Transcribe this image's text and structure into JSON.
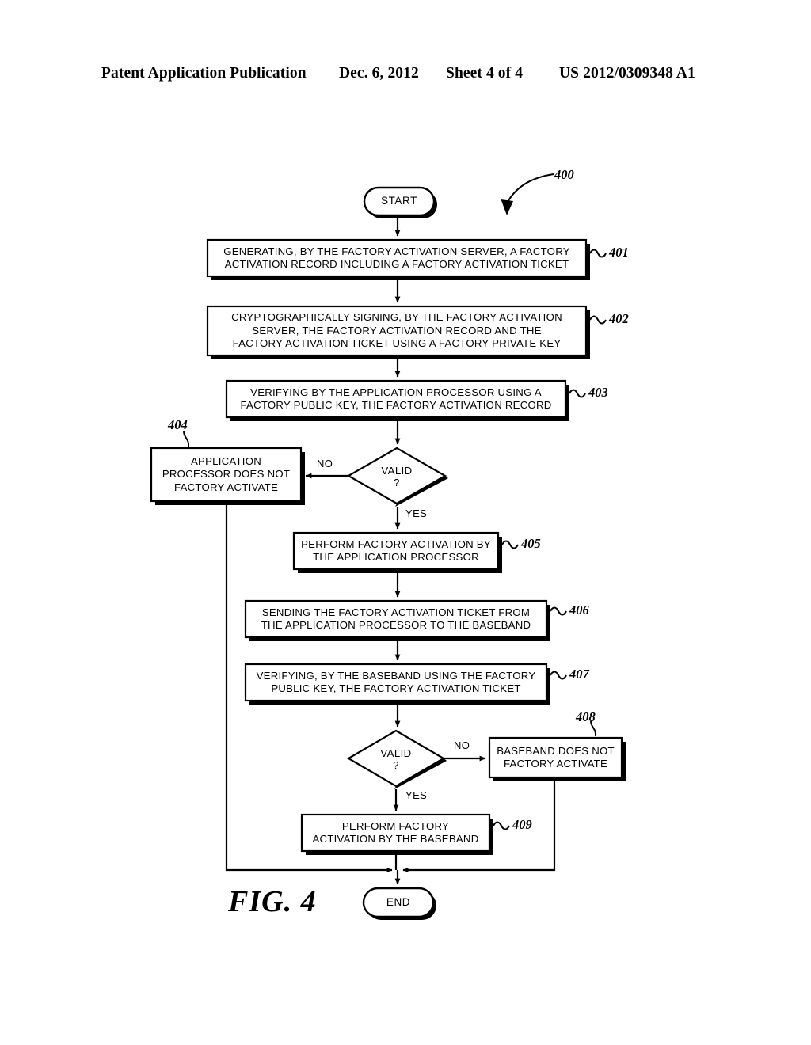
{
  "header": {
    "publication": "Patent Application Publication",
    "date": "Dec. 6, 2012",
    "sheet": "Sheet 4 of 4",
    "patent_number": "US 2012/0309348 A1"
  },
  "figure": {
    "label": "FIG. 4",
    "diagram_ref": "400",
    "type": "flowchart"
  },
  "nodes": {
    "start": {
      "ref": "",
      "text": "START",
      "shape": "terminal"
    },
    "n401": {
      "ref": "401",
      "text": "GENERATING, BY THE FACTORY ACTIVATION SERVER, A FACTORY\nACTIVATION RECORD INCLUDING A FACTORY ACTIVATION TICKET",
      "shape": "process"
    },
    "n402": {
      "ref": "402",
      "text": "CRYPTOGRAPHICALLY SIGNING, BY THE FACTORY ACTIVATION\nSERVER, THE FACTORY ACTIVATION RECORD AND THE\nFACTORY ACTIVATION TICKET USING A FACTORY PRIVATE KEY",
      "shape": "process"
    },
    "n403": {
      "ref": "403",
      "text": "VERIFYING BY THE APPLICATION PROCESSOR USING A\nFACTORY PUBLIC KEY, THE FACTORY ACTIVATION RECORD",
      "shape": "process"
    },
    "d1": {
      "ref": "",
      "text": "VALID\n?",
      "shape": "decision"
    },
    "n404": {
      "ref": "404",
      "text": "APPLICATION\nPROCESSOR DOES NOT\nFACTORY ACTIVATE",
      "shape": "process"
    },
    "n405": {
      "ref": "405",
      "text": "PERFORM FACTORY ACTIVATION BY\nTHE APPLICATION PROCESSOR",
      "shape": "process"
    },
    "n406": {
      "ref": "406",
      "text": "SENDING THE FACTORY ACTIVATION TICKET FROM\nTHE APPLICATION PROCESSOR TO THE BASEBAND",
      "shape": "process"
    },
    "n407": {
      "ref": "407",
      "text": "VERIFYING, BY THE BASEBAND USING THE FACTORY\nPUBLIC KEY, THE FACTORY ACTIVATION TICKET",
      "shape": "process"
    },
    "d2": {
      "ref": "",
      "text": "VALID\n?",
      "shape": "decision"
    },
    "n408": {
      "ref": "408",
      "text": "BASEBAND DOES NOT\nFACTORY ACTIVATE",
      "shape": "process"
    },
    "n409": {
      "ref": "409",
      "text": "PERFORM FACTORY\nACTIVATION BY THE BASEBAND",
      "shape": "process"
    },
    "end": {
      "ref": "",
      "text": "END",
      "shape": "terminal"
    }
  },
  "edge_labels": {
    "d1_no": "NO",
    "d1_yes": "YES",
    "d2_no": "NO",
    "d2_yes": "YES"
  },
  "colors": {
    "ink": "#000000",
    "paper": "#ffffff"
  }
}
